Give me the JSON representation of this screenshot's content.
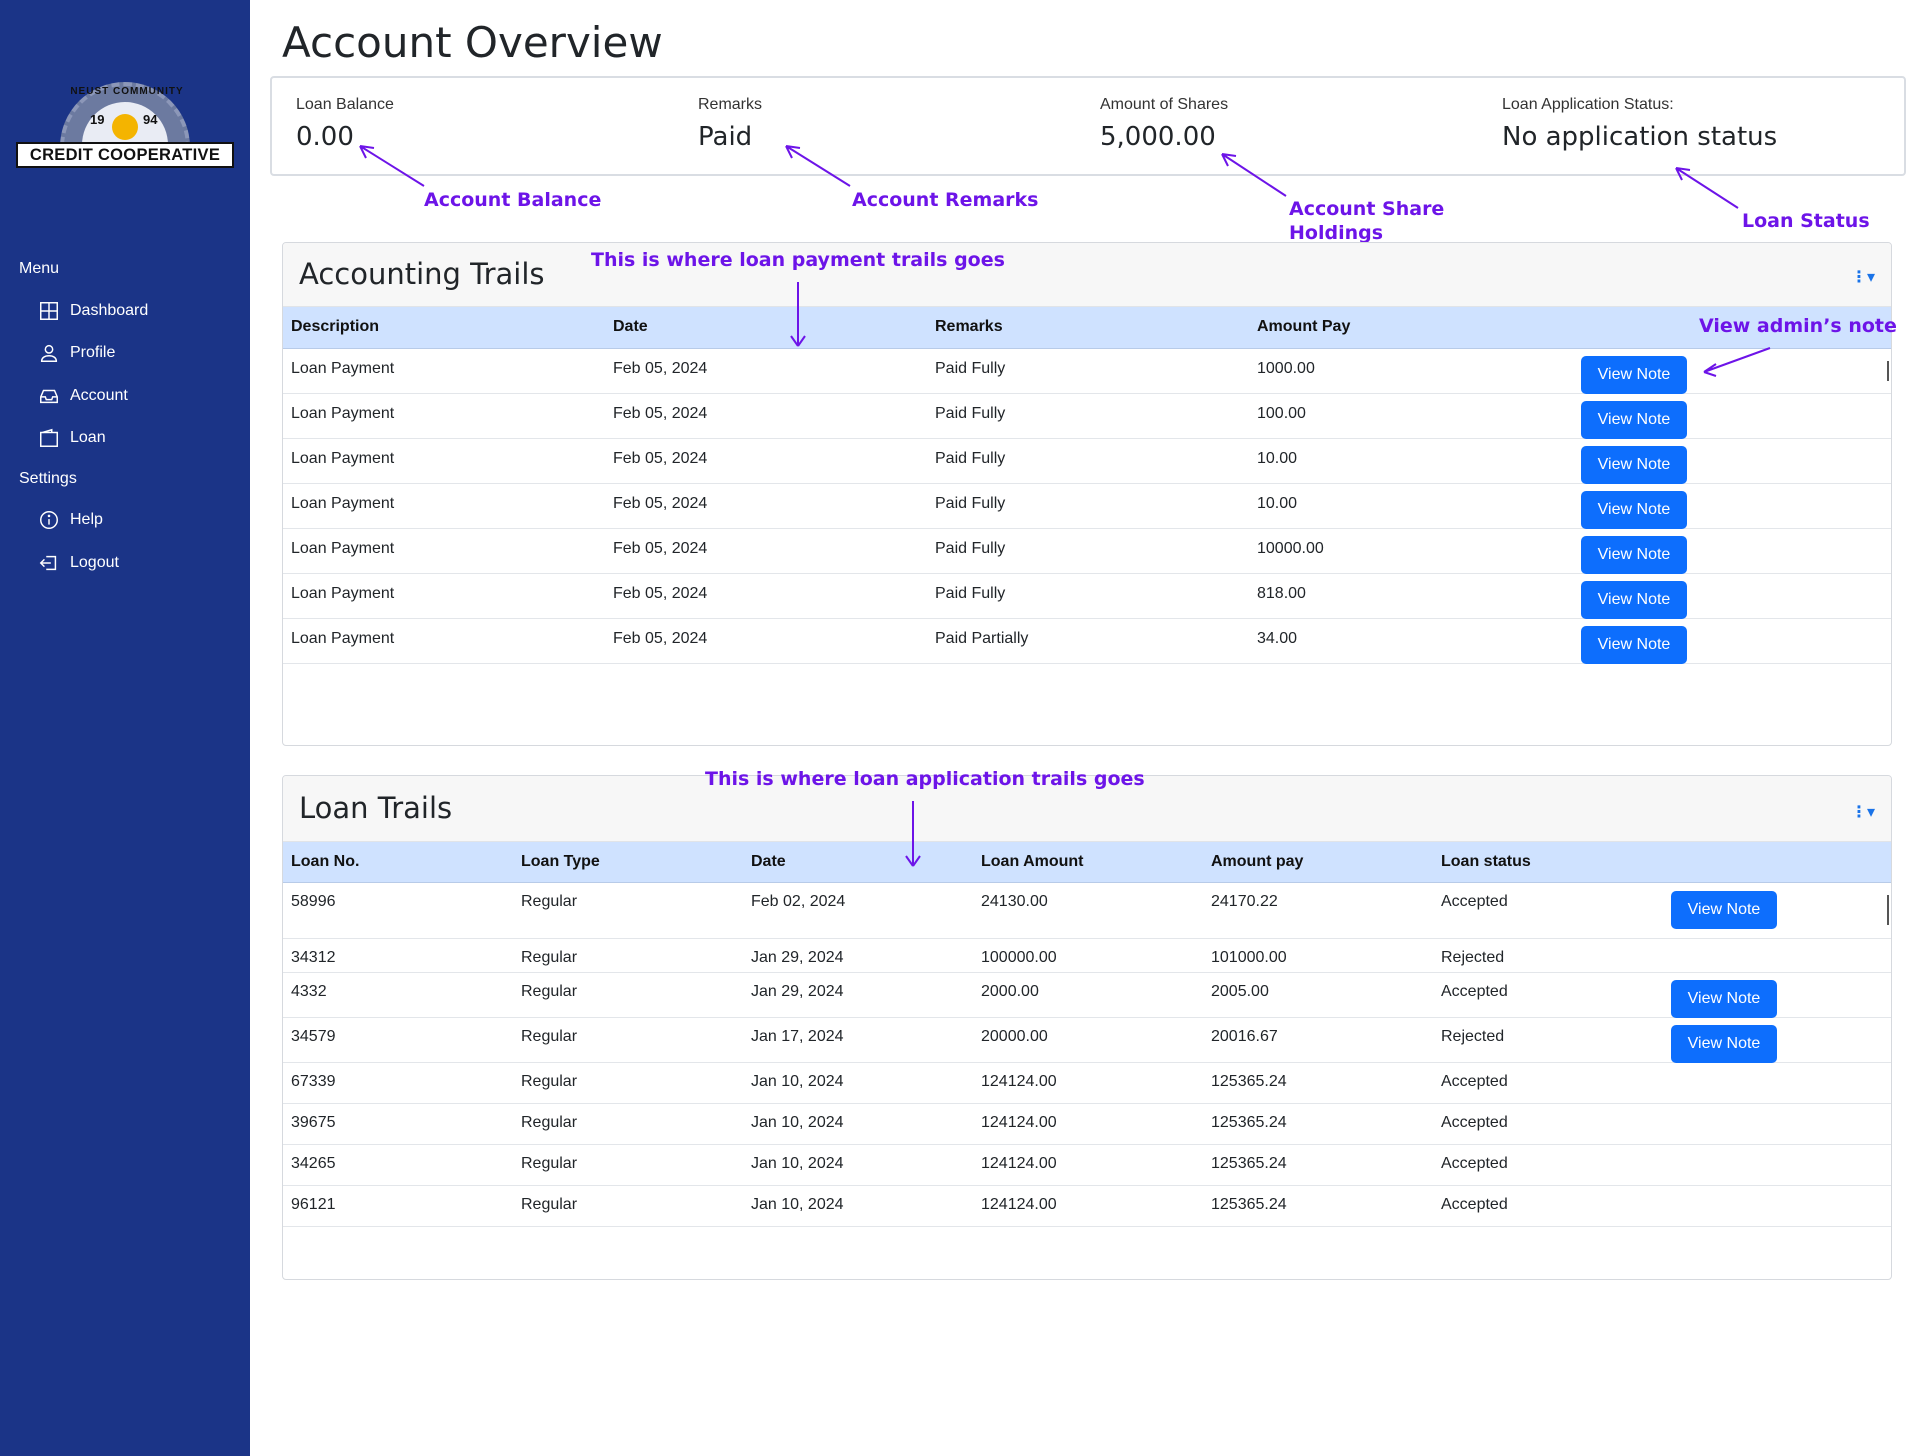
{
  "sidebar": {
    "logo": {
      "banner": "CREDIT COOPERATIVE",
      "arc_text": "NEUST COMMUNITY",
      "year_left": "19",
      "year_right": "94"
    },
    "menu_heading": "Menu",
    "menu_items": [
      {
        "label": "Dashboard",
        "icon": "grid-icon"
      },
      {
        "label": "Profile",
        "icon": "user-icon"
      },
      {
        "label": "Account",
        "icon": "inbox-icon"
      },
      {
        "label": "Loan",
        "icon": "wallet-icon"
      }
    ],
    "settings_heading": "Settings",
    "settings_items": [
      {
        "label": "Help",
        "icon": "info-icon"
      },
      {
        "label": "Logout",
        "icon": "logout-icon"
      }
    ]
  },
  "page_title": "Account Overview",
  "summary": {
    "loan_balance": {
      "label": "Loan Balance",
      "value": "0.00"
    },
    "remarks": {
      "label": "Remarks",
      "value": "Paid"
    },
    "shares": {
      "label": "Amount of Shares",
      "value": "5,000.00"
    },
    "status": {
      "label": "Loan Application Status:",
      "value": "No application status"
    }
  },
  "callouts": {
    "account_balance": "Account Balance",
    "account_remarks": "Account Remarks",
    "account_share_line1": "Account Share",
    "account_share_line2": "Holdings",
    "loan_status": "Loan Status",
    "payment_trails": "This is where loan payment trails goes",
    "admin_note": "View admin’s note",
    "application_trails": "This is where loan application trails goes"
  },
  "accounting_trails": {
    "title": "Accounting Trails",
    "kebab": "⋮▾",
    "columns": [
      "Description",
      "Date",
      "Remarks",
      "Amount Pay"
    ],
    "button_label": "View Note",
    "rows": [
      {
        "description": "Loan Payment",
        "date": "Feb 05, 2024",
        "remarks": "Paid Fully",
        "amount": "1000.00"
      },
      {
        "description": "Loan Payment",
        "date": "Feb 05, 2024",
        "remarks": "Paid Fully",
        "amount": "100.00"
      },
      {
        "description": "Loan Payment",
        "date": "Feb 05, 2024",
        "remarks": "Paid Fully",
        "amount": "10.00"
      },
      {
        "description": "Loan Payment",
        "date": "Feb 05, 2024",
        "remarks": "Paid Fully",
        "amount": "10.00"
      },
      {
        "description": "Loan Payment",
        "date": "Feb 05, 2024",
        "remarks": "Paid Fully",
        "amount": "10000.00"
      },
      {
        "description": "Loan Payment",
        "date": "Feb 05, 2024",
        "remarks": "Paid Fully",
        "amount": "818.00"
      },
      {
        "description": "Loan Payment",
        "date": "Feb 05, 2024",
        "remarks": "Paid Partially",
        "amount": "34.00"
      }
    ]
  },
  "loan_trails": {
    "title": "Loan Trails",
    "kebab": "⋮▾",
    "columns": [
      "Loan No.",
      "Loan Type",
      "Date",
      "Loan Amount",
      "Amount pay",
      "Loan status"
    ],
    "button_label": "View Note",
    "rows": [
      {
        "no": "58996",
        "type": "Regular",
        "date": "Feb 02, 2024",
        "amount": "24130.00",
        "pay": "24170.22",
        "status": "Accepted",
        "has_note": true
      },
      {
        "no": "34312",
        "type": "Regular",
        "date": "Jan 29, 2024",
        "amount": "100000.00",
        "pay": "101000.00",
        "status": "Rejected",
        "has_note": false
      },
      {
        "no": "4332",
        "type": "Regular",
        "date": "Jan 29, 2024",
        "amount": "2000.00",
        "pay": "2005.00",
        "status": "Accepted",
        "has_note": true
      },
      {
        "no": "34579",
        "type": "Regular",
        "date": "Jan 17, 2024",
        "amount": "20000.00",
        "pay": "20016.67",
        "status": "Rejected",
        "has_note": true
      },
      {
        "no": "67339",
        "type": "Regular",
        "date": "Jan 10, 2024",
        "amount": "124124.00",
        "pay": "125365.24",
        "status": "Accepted",
        "has_note": false
      },
      {
        "no": "39675",
        "type": "Regular",
        "date": "Jan 10, 2024",
        "amount": "124124.00",
        "pay": "125365.24",
        "status": "Accepted",
        "has_note": false
      },
      {
        "no": "34265",
        "type": "Regular",
        "date": "Jan 10, 2024",
        "amount": "124124.00",
        "pay": "125365.24",
        "status": "Accepted",
        "has_note": false
      },
      {
        "no": "96121",
        "type": "Regular",
        "date": "Jan 10, 2024",
        "amount": "124124.00",
        "pay": "125365.24",
        "status": "Accepted",
        "has_note": false
      }
    ]
  },
  "colors": {
    "sidebar": "#1b3487",
    "accent": "#0d6efd",
    "table_header": "#cfe2ff",
    "annotation": "#6d14e8"
  }
}
